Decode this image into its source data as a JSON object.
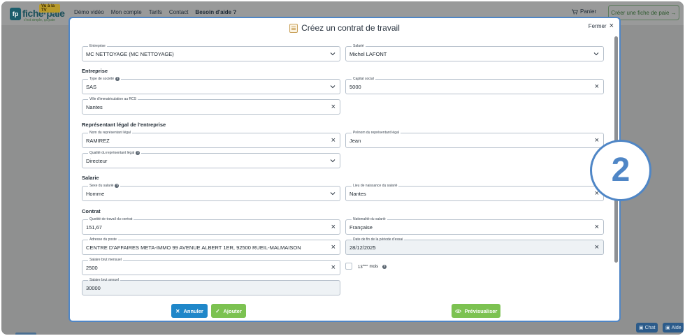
{
  "nav": {
    "logo_name": "fiche·paie",
    "logo_tv": "Vu à la TV",
    "logo_tagline": "c'est simple, ça paie",
    "links": [
      "Démo vidéo",
      "Mon compte",
      "Tarifs",
      "Contact",
      "Besoin d'aide ?"
    ],
    "cart_label": "Panier",
    "cta_label": "Créer une fiche de paie →"
  },
  "bottom": {
    "chat": "Chat",
    "help": "Aide"
  },
  "modal": {
    "title": "Créez un contrat de travail",
    "close_label": "Fermer",
    "fields": {
      "entreprise": {
        "label": "Entreprise",
        "value": "MC NETTOYAGE (MC NETTOYAGE)"
      },
      "salarie": {
        "label": "Salarié",
        "value": "Michel LAFONT"
      },
      "type_societe": {
        "label": "Type de société",
        "value": "SAS"
      },
      "capital_social": {
        "label": "Capital social",
        "value": "5000"
      },
      "ville_rcs": {
        "label": "Ville d'immatriculation au RCS",
        "value": "Nantes"
      },
      "nom_representant": {
        "label": "Nom du représentant légal",
        "value": "RAMIREZ"
      },
      "prenom_representant": {
        "label": "Prénom du représentant légal",
        "value": "Jean"
      },
      "qualite_representant": {
        "label": "Qualité du représentant légal",
        "value": "Directeur"
      },
      "sexe_salarie": {
        "label": "Sexe du salarié",
        "value": "Homme"
      },
      "lieu_naissance": {
        "label": "Lieu de naissance du salarié",
        "value": "Nantes"
      },
      "quotite_travail": {
        "label": "Quotité de travail du contrat",
        "value": "151,67"
      },
      "nationalite": {
        "label": "Nationalité du salarié",
        "value": "Française"
      },
      "adresse_poste": {
        "label": "Adresse du poste",
        "value": "CENTRE D'AFFAIRES META-IMMO 99 AVENUE ALBERT 1ER, 92500 RUEIL-MALMAISON"
      },
      "date_fin_essai": {
        "label": "Date de fin de la période d'essai",
        "value": "28/12/2025"
      },
      "salaire_mensuel": {
        "label": "Salaire brut mensuel",
        "value": "2500"
      },
      "salaire_annuel": {
        "label": "Salaire brut annuel",
        "value": "30000"
      }
    },
    "sections": {
      "entreprise": "Entreprise",
      "representant": "Représentant légal de l'entreprise",
      "salarie": "Salarie",
      "contrat": "Contrat"
    },
    "treizieme": {
      "prefix": "13",
      "sup": "ème",
      "suffix": "mois"
    },
    "buttons": {
      "annuler": "Annuler",
      "ajouter": "Ajouter",
      "previsualiser": "Prévisualiser"
    }
  },
  "step_badge": "2",
  "colors": {
    "accent": "#4f86c6",
    "green": "#7cc251",
    "blue": "#1f87c9"
  }
}
